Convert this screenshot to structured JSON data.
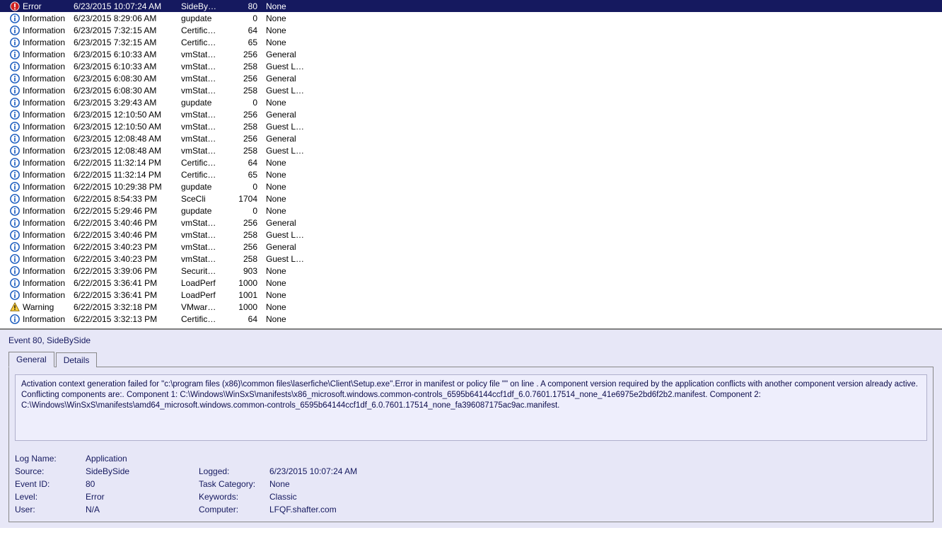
{
  "events": [
    {
      "level": "Error",
      "date": "6/23/2015 10:07:24 AM",
      "src": "SideBy…",
      "id": "80",
      "cat": "None"
    },
    {
      "level": "Information",
      "date": "6/23/2015 8:29:06 AM",
      "src": "gupdate",
      "id": "0",
      "cat": "None"
    },
    {
      "level": "Information",
      "date": "6/23/2015 7:32:15 AM",
      "src": "Certific…",
      "id": "64",
      "cat": "None"
    },
    {
      "level": "Information",
      "date": "6/23/2015 7:32:15 AM",
      "src": "Certific…",
      "id": "65",
      "cat": "None"
    },
    {
      "level": "Information",
      "date": "6/23/2015 6:10:33 AM",
      "src": "vmStat…",
      "id": "256",
      "cat": "General"
    },
    {
      "level": "Information",
      "date": "6/23/2015 6:10:33 AM",
      "src": "vmStat…",
      "id": "258",
      "cat": "Guest L…"
    },
    {
      "level": "Information",
      "date": "6/23/2015 6:08:30 AM",
      "src": "vmStat…",
      "id": "256",
      "cat": "General"
    },
    {
      "level": "Information",
      "date": "6/23/2015 6:08:30 AM",
      "src": "vmStat…",
      "id": "258",
      "cat": "Guest L…"
    },
    {
      "level": "Information",
      "date": "6/23/2015 3:29:43 AM",
      "src": "gupdate",
      "id": "0",
      "cat": "None"
    },
    {
      "level": "Information",
      "date": "6/23/2015 12:10:50 AM",
      "src": "vmStat…",
      "id": "256",
      "cat": "General"
    },
    {
      "level": "Information",
      "date": "6/23/2015 12:10:50 AM",
      "src": "vmStat…",
      "id": "258",
      "cat": "Guest L…"
    },
    {
      "level": "Information",
      "date": "6/23/2015 12:08:48 AM",
      "src": "vmStat…",
      "id": "256",
      "cat": "General"
    },
    {
      "level": "Information",
      "date": "6/23/2015 12:08:48 AM",
      "src": "vmStat…",
      "id": "258",
      "cat": "Guest L…"
    },
    {
      "level": "Information",
      "date": "6/22/2015 11:32:14 PM",
      "src": "Certific…",
      "id": "64",
      "cat": "None"
    },
    {
      "level": "Information",
      "date": "6/22/2015 11:32:14 PM",
      "src": "Certific…",
      "id": "65",
      "cat": "None"
    },
    {
      "level": "Information",
      "date": "6/22/2015 10:29:38 PM",
      "src": "gupdate",
      "id": "0",
      "cat": "None"
    },
    {
      "level": "Information",
      "date": "6/22/2015 8:54:33 PM",
      "src": "SceCli",
      "id": "1704",
      "cat": "None"
    },
    {
      "level": "Information",
      "date": "6/22/2015 5:29:46 PM",
      "src": "gupdate",
      "id": "0",
      "cat": "None"
    },
    {
      "level": "Information",
      "date": "6/22/2015 3:40:46 PM",
      "src": "vmStat…",
      "id": "256",
      "cat": "General"
    },
    {
      "level": "Information",
      "date": "6/22/2015 3:40:46 PM",
      "src": "vmStat…",
      "id": "258",
      "cat": "Guest L…"
    },
    {
      "level": "Information",
      "date": "6/22/2015 3:40:23 PM",
      "src": "vmStat…",
      "id": "256",
      "cat": "General"
    },
    {
      "level": "Information",
      "date": "6/22/2015 3:40:23 PM",
      "src": "vmStat…",
      "id": "258",
      "cat": "Guest L…"
    },
    {
      "level": "Information",
      "date": "6/22/2015 3:39:06 PM",
      "src": "Securit…",
      "id": "903",
      "cat": "None"
    },
    {
      "level": "Information",
      "date": "6/22/2015 3:36:41 PM",
      "src": "LoadPerf",
      "id": "1000",
      "cat": "None"
    },
    {
      "level": "Information",
      "date": "6/22/2015 3:36:41 PM",
      "src": "LoadPerf",
      "id": "1001",
      "cat": "None"
    },
    {
      "level": "Warning",
      "date": "6/22/2015 3:32:18 PM",
      "src": "VMwar…",
      "id": "1000",
      "cat": "None"
    },
    {
      "level": "Information",
      "date": "6/22/2015 3:32:13 PM",
      "src": "Certific…",
      "id": "64",
      "cat": "None"
    }
  ],
  "detail": {
    "header": "Event 80, SideBySide",
    "tab_general": "General",
    "tab_details": "Details",
    "message": "Activation context generation failed for \"c:\\program files (x86)\\common files\\laserfiche\\Client\\Setup.exe\".Error in manifest or policy file \"\" on line . A component version required by the application conflicts with another component version already active. Conflicting components are:. Component 1: C:\\Windows\\WinSxS\\manifests\\x86_microsoft.windows.common-controls_6595b64144ccf1df_6.0.7601.17514_none_41e6975e2bd6f2b2.manifest. Component 2: C:\\Windows\\WinSxS\\manifests\\amd64_microsoft.windows.common-controls_6595b64144ccf1df_6.0.7601.17514_none_fa396087175ac9ac.manifest.",
    "labels": {
      "log_name": "Log Name:",
      "source": "Source:",
      "event_id": "Event ID:",
      "level": "Level:",
      "user": "User:",
      "logged": "Logged:",
      "task": "Task Category:",
      "keywords": "Keywords:",
      "computer": "Computer:"
    },
    "values": {
      "log_name": "Application",
      "source": "SideBySide",
      "event_id": "80",
      "level": "Error",
      "user": "N/A",
      "logged": "6/23/2015 10:07:24 AM",
      "task": "None",
      "keywords": "Classic",
      "computer": "LFQF.shafter.com"
    }
  }
}
